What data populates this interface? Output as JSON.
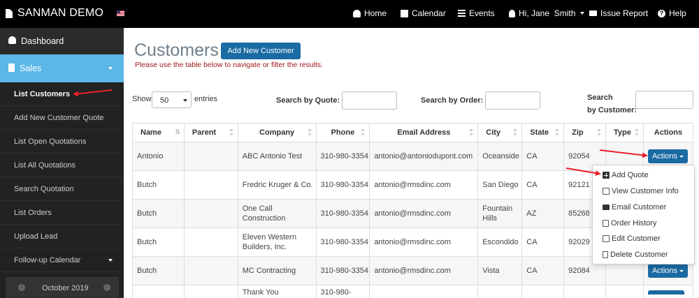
{
  "topbar": {
    "brand": "SANMAN DEMO",
    "nav": [
      {
        "label": "Home",
        "icon": "dashboard-icon"
      },
      {
        "label": "Calendar",
        "icon": "calendar-icon"
      },
      {
        "label": "Events",
        "icon": "list-icon"
      },
      {
        "label": "Hi, Jane  Smith",
        "icon": "user-icon"
      },
      {
        "label": "Issue Report",
        "icon": "envelope-icon"
      },
      {
        "label": "Help",
        "icon": "question-icon"
      }
    ]
  },
  "sidebar": {
    "dashboard": "Dashboard",
    "sales": "Sales",
    "items": [
      {
        "label": "List Customers"
      },
      {
        "label": "Add New Customer Quote"
      },
      {
        "label": "List Open Quotations"
      },
      {
        "label": "List All Quotations"
      },
      {
        "label": "Search Quotation"
      },
      {
        "label": "List Orders"
      },
      {
        "label": "Upload Lead"
      },
      {
        "label": "Follow-up Calendar"
      }
    ],
    "calendar_month": "October 2019"
  },
  "main": {
    "title": "Customers",
    "add_button": "Add New Customer",
    "subtitle": "Please use the table below to navigate or filter the results."
  },
  "controls": {
    "show_label": "Show",
    "entries_value": "50",
    "entries_label": "entries",
    "search_quote_label": "Search by Quote:",
    "search_order_label": "Search by Order:",
    "search_customer_label_1": "Search",
    "search_customer_label_2": "by Customer:"
  },
  "table": {
    "headers": [
      "Name",
      "Parent",
      "Company",
      "Phone",
      "Email Address",
      "City",
      "State",
      "Zip",
      "Type",
      "Actions"
    ],
    "rows": [
      {
        "name": "Antonio",
        "parent": "",
        "company": "ABC Antonio Test",
        "phone": "310-980-3354",
        "email": "antonio@antoniodupont.com",
        "city": "Oceanside",
        "state": "CA",
        "zip": "92054",
        "type": ""
      },
      {
        "name": "Butch",
        "parent": "",
        "company": "Fredric Kruger & Co.",
        "phone": "310-980-3354",
        "email": "antonio@rmsdinc.com",
        "city": "San Diego",
        "state": "CA",
        "zip": "92121",
        "type": ""
      },
      {
        "name": "Butch",
        "parent": "",
        "company": "One Call Construction",
        "phone": "310-980-3354",
        "email": "antonio@rmsdinc.com",
        "city": "Fountain Hills",
        "state": "AZ",
        "zip": "85268",
        "type": ""
      },
      {
        "name": "Butch",
        "parent": "",
        "company": "Eleven Western Builders, Inc.",
        "phone": "310-980-3354",
        "email": "antonio@rmsdinc.com",
        "city": "Escondido",
        "state": "CA",
        "zip": "92029",
        "type": ""
      },
      {
        "name": "Butch",
        "parent": "",
        "company": "MC Contracting",
        "phone": "310-980-3354",
        "email": "antonio@rmsdinc.com",
        "city": "Vista",
        "state": "CA",
        "zip": "92084",
        "type": ""
      },
      {
        "name": "",
        "parent": "",
        "company": "Thank You",
        "phone": "310-980-",
        "email": "",
        "city": "",
        "state": "",
        "zip": "",
        "type": ""
      }
    ],
    "actions_label": "Actions"
  },
  "dropdown": {
    "items": [
      "Add Quote",
      "View Customer Info",
      "Email Customer",
      "Order History",
      "Edit Customer",
      "Delete Customer"
    ]
  },
  "colors": {
    "primary": "#1a6aa3",
    "sales_active": "#5bb7e8",
    "annotation": "#e8202a",
    "subtitle": "#a01818"
  }
}
